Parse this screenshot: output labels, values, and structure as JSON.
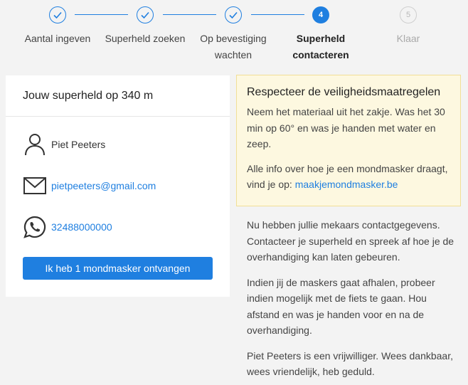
{
  "stepper": {
    "steps": [
      {
        "label": "Aantal ingeven",
        "state": "done"
      },
      {
        "label": "Superheld zoeken",
        "state": "done"
      },
      {
        "label": "Op bevestiging wachten",
        "state": "done"
      },
      {
        "label": "Superheld contacteren",
        "number": "4",
        "state": "active"
      },
      {
        "label": "Klaar",
        "number": "5",
        "state": "todo"
      }
    ]
  },
  "card": {
    "title": "Jouw superheld op 340 m",
    "name": "Piet Peeters",
    "email": "pietpeeters@gmail.com",
    "phone": "32488000000",
    "button_label": "Ik heb 1 mondmasker ontvangen"
  },
  "warning": {
    "title": "Respecteer de veiligheidsmaatregelen",
    "text1": "Neem het materiaal uit het zakje. Was het 30 min op 60° en was je handen met water en zeep.",
    "text2_prefix": "Alle info over hoe je een mondmasker draagt, vind je op: ",
    "link": "maakjemondmasker.be"
  },
  "info": {
    "p1": "Nu hebben jullie mekaars contactgegevens. Contacteer je superheld en spreek af hoe je de overhandiging kan laten gebeuren.",
    "p2": "Indien jij de maskers gaat afhalen, probeer indien mogelijk met de fiets te gaan. Hou afstand en was je handen voor en na de overhandiging.",
    "p3": "Piet Peeters is een vrijwilliger. Wees dankbaar, wees vriendelijk, heb geduld."
  },
  "colors": {
    "accent": "#1f7fe0",
    "warning_bg": "#fdf8e0",
    "background": "#f3f3f3"
  }
}
